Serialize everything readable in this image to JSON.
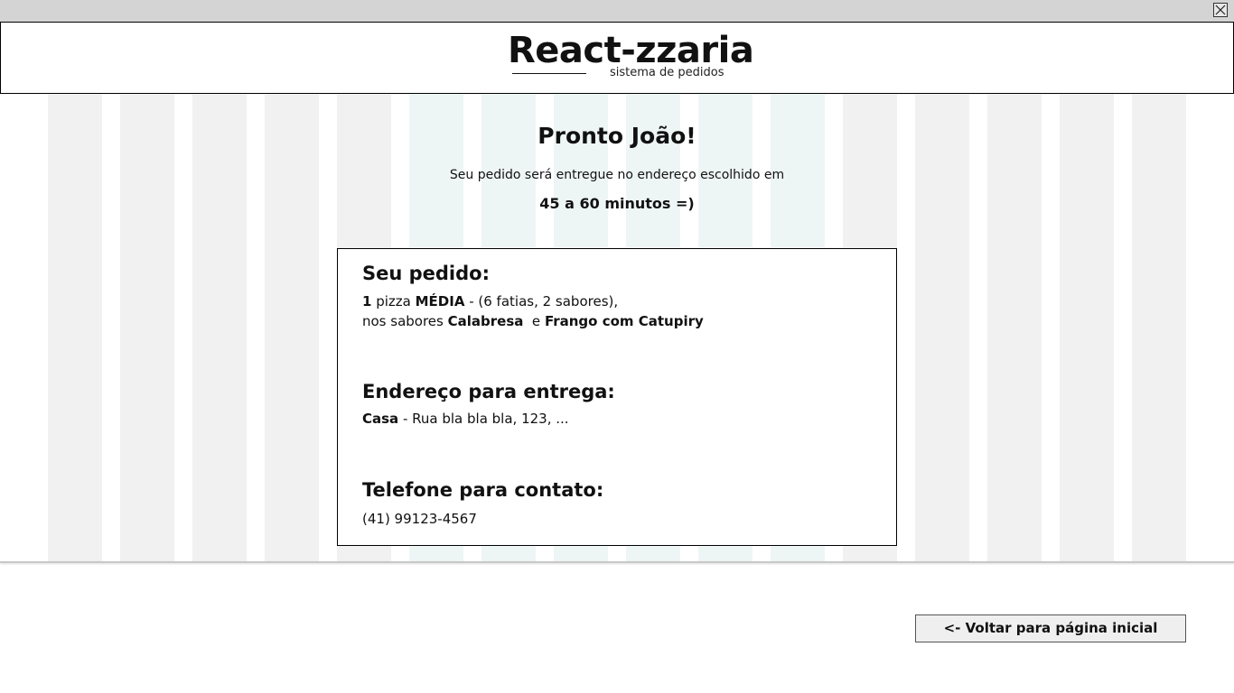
{
  "window": {
    "close_icon": "close-icon"
  },
  "header": {
    "title": "React-zzaria",
    "subtitle": "sistema de pedidos"
  },
  "confirmation": {
    "title": "Pronto João!",
    "message": "Seu pedido será entregue no endereço escolhido em",
    "eta": "45 a 60 minutos =)"
  },
  "order": {
    "heading": "Seu pedido:",
    "quantity": "1",
    "item_word": " pizza ",
    "size": "MÉDIA",
    "size_detail": " - (6 fatias, 2 sabores),",
    "flavors_prefix": "nos sabores ",
    "flavor_1": "Calabresa",
    "flavor_separator": "  e ",
    "flavor_2": "Frango com Catupiry"
  },
  "address": {
    "heading": "Endereço para entrega:",
    "label": "Casa",
    "detail": " - Rua bla bla bla, 123, ..."
  },
  "phone": {
    "heading": "Telefone para contato:",
    "value": "(41) 99123-4567"
  },
  "actions": {
    "back_label": "<- Voltar para página inicial"
  },
  "colors": {
    "grid_column": "#f1f1f1",
    "grid_column_highlight": "#eef6f5",
    "topbar": "#d4d4d4"
  }
}
